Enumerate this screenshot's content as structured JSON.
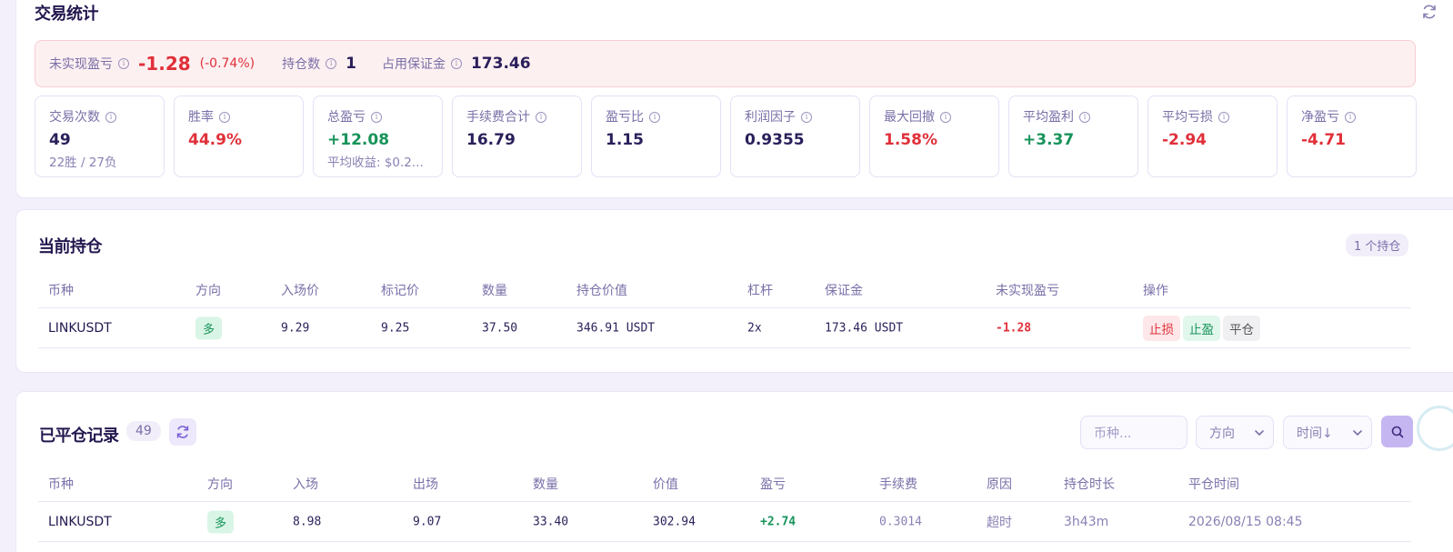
{
  "stats": {
    "title": "交易统计",
    "summary": {
      "unrealized_label": "未实现盈亏",
      "unrealized_value": "-1.28",
      "unrealized_pct": "(-0.74%)",
      "positions_label": "持仓数",
      "positions_value": "1",
      "margin_label": "占用保证金",
      "margin_value": "173.46"
    },
    "boxes": [
      {
        "label": "交易次数",
        "value": "49",
        "sub": "22胜 / 27负",
        "tone": "normal"
      },
      {
        "label": "胜率",
        "value": "44.9%",
        "sub": "",
        "tone": "neg"
      },
      {
        "label": "总盈亏",
        "value": "+12.08",
        "sub": "平均收益: $0.2...",
        "tone": "pos"
      },
      {
        "label": "手续费合计",
        "value": "16.79",
        "sub": "",
        "tone": "normal"
      },
      {
        "label": "盈亏比",
        "value": "1.15",
        "sub": "",
        "tone": "normal"
      },
      {
        "label": "利润因子",
        "value": "0.9355",
        "sub": "",
        "tone": "normal"
      },
      {
        "label": "最大回撤",
        "value": "1.58%",
        "sub": "",
        "tone": "neg"
      },
      {
        "label": "平均盈利",
        "value": "+3.37",
        "sub": "",
        "tone": "pos"
      },
      {
        "label": "平均亏损",
        "value": "-2.94",
        "sub": "",
        "tone": "neg"
      },
      {
        "label": "净盈亏",
        "value": "-4.71",
        "sub": "",
        "tone": "neg"
      }
    ]
  },
  "positions": {
    "title": "当前持仓",
    "count": "1 个持仓",
    "headers": {
      "symbol": "币种",
      "direction": "方向",
      "entry": "入场价",
      "mark": "标记价",
      "qty": "数量",
      "value": "持仓价值",
      "leverage": "杠杆",
      "margin": "保证金",
      "upnl": "未实现盈亏",
      "actions": "操作"
    },
    "rows": [
      {
        "symbol": "LINKUSDT",
        "direction": "多",
        "entry": "9.29",
        "mark": "9.25",
        "qty": "37.50",
        "value": "346.91 USDT",
        "leverage": "2x",
        "margin": "173.46 USDT",
        "upnl": "-1.28"
      }
    ],
    "actions": {
      "stop_loss": "止损",
      "take_profit": "止盈",
      "close": "平仓"
    }
  },
  "closed": {
    "title": "已平仓记录",
    "count": "49",
    "filters": {
      "symbol_placeholder": "币种...",
      "direction": "方向",
      "sort": "时间↓"
    },
    "headers": {
      "symbol": "币种",
      "direction": "方向",
      "entry": "入场",
      "exit": "出场",
      "qty": "数量",
      "value": "价值",
      "pnl": "盈亏",
      "fee": "手续费",
      "reason": "原因",
      "duration": "持仓时长",
      "close_time": "平仓时间"
    },
    "rows": [
      {
        "symbol": "LINKUSDT",
        "direction": "多",
        "entry": "8.98",
        "exit": "9.07",
        "qty": "33.40",
        "value": "302.94",
        "pnl": "+2.74",
        "fee": "0.3014",
        "reason": "超时",
        "duration": "3h43m",
        "close_time": "2026/08/15 08:45"
      }
    ]
  },
  "colors": {
    "accent": "#c5b6f2",
    "positive": "#17935a",
    "negative": "#e0303a",
    "background": "#f3f0fb"
  }
}
